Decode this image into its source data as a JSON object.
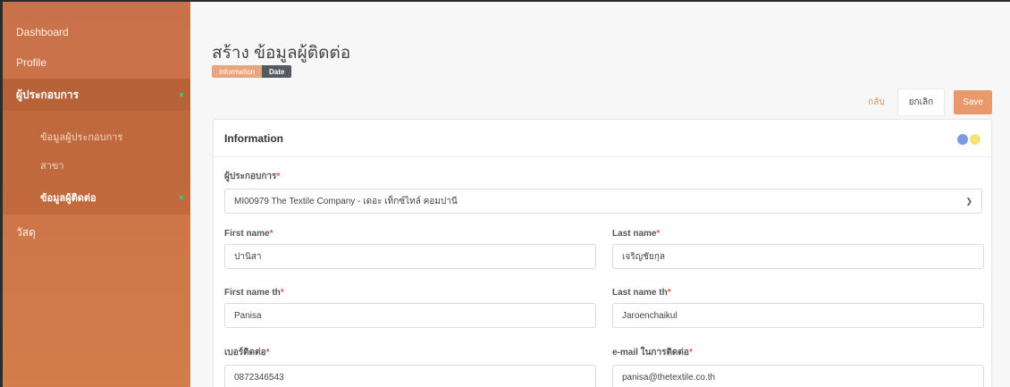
{
  "sidebar": {
    "items": [
      {
        "label": "Dashboard"
      },
      {
        "label": "Profile"
      },
      {
        "label": "ผู้ประกอบการ"
      },
      {
        "label": "วัสดุ"
      }
    ],
    "submenu": [
      {
        "label": "ข้อมูลผู้ประกอบการ"
      },
      {
        "label": "สาขา"
      },
      {
        "label": "ข้อมูลผู้ติดต่อ"
      }
    ]
  },
  "page": {
    "title": "สร้าง ข้อมูลผู้ติดต่อ",
    "tabs": [
      "Information",
      "Date"
    ]
  },
  "actions": {
    "back": "กลับ",
    "cancel": "ยกเลิก",
    "save": "Save"
  },
  "card": {
    "title": "Information",
    "indicator_colors": [
      "#7b9be0",
      "#f3e37a"
    ]
  },
  "form": {
    "company": {
      "label": "ผู้ประกอบการ",
      "required": "*",
      "value": "MI00979 The Textile Company - เดอะ เท็กซ์ไทล์ คอมปานี"
    },
    "first_name": {
      "label": "First name",
      "required": "*",
      "value": "ปานิสา"
    },
    "last_name": {
      "label": "Last name",
      "required": "*",
      "value": "เจริญชัยกุล"
    },
    "first_name_th": {
      "label": "First name th",
      "required": "*",
      "value": "Panisa"
    },
    "last_name_th": {
      "label": "Last name th",
      "required": "*",
      "value": "Jaroenchaikul"
    },
    "phone": {
      "label": "เบอร์ติดต่อ",
      "required": "*",
      "value": "0872346543"
    },
    "email": {
      "label": "e-mail ในการติดต่อ",
      "required": "*",
      "value": "panisa@thetextile.co.th"
    }
  }
}
